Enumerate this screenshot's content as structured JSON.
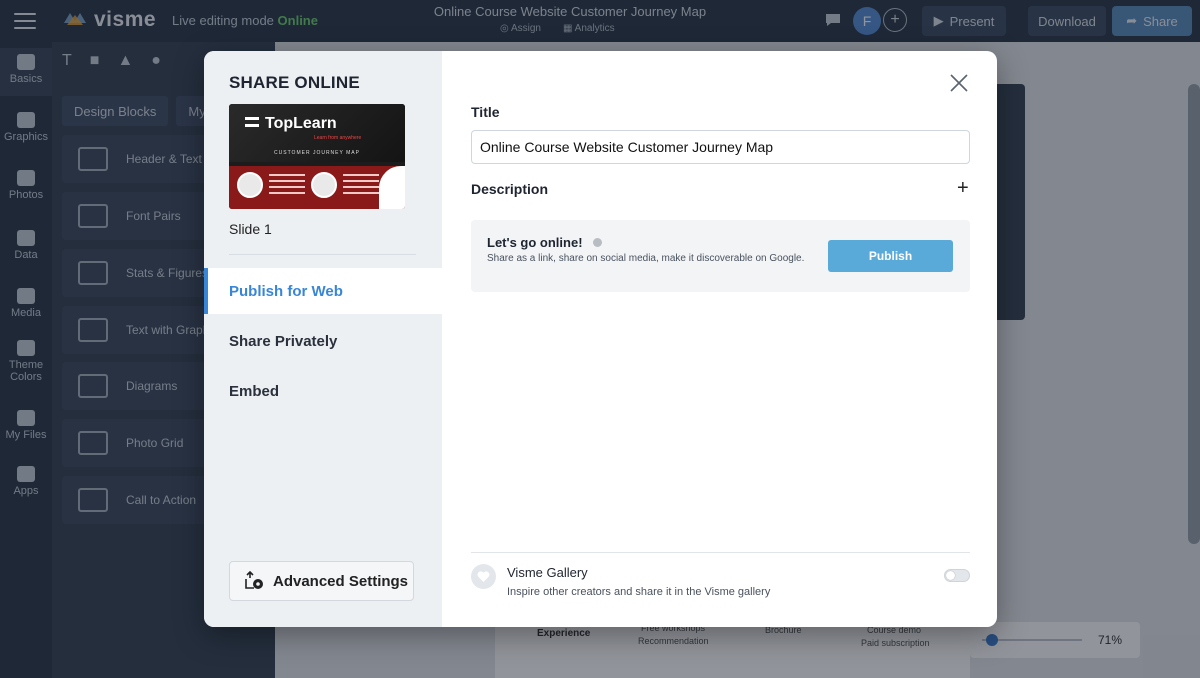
{
  "app": {
    "brand": "visme",
    "mode_text": "Live editing mode",
    "mode_status": "Online",
    "doc_title": "Online Course Website Customer Journey Map",
    "assign_label": "Assign",
    "analytics_label": "Analytics",
    "avatar_initial": "F",
    "present_label": "Present",
    "download_label": "Download",
    "share_label": "Share"
  },
  "rail": {
    "items": [
      {
        "label": "Basics"
      },
      {
        "label": "Graphics"
      },
      {
        "label": "Photos"
      },
      {
        "label": "Data"
      },
      {
        "label": "Media"
      },
      {
        "label": "Theme Colors"
      },
      {
        "label": "My Files"
      },
      {
        "label": "Apps"
      }
    ]
  },
  "panel": {
    "tab_blocks": "Design Blocks",
    "tab_my": "My",
    "blocks": [
      {
        "label": "Header & Text"
      },
      {
        "label": "Font Pairs"
      },
      {
        "label": "Stats & Figures"
      },
      {
        "label": "Text with Graph"
      },
      {
        "label": "Diagrams"
      },
      {
        "label": "Photo Grid"
      },
      {
        "label": "Call to Action"
      }
    ]
  },
  "canvas": {
    "row_label": "Experience",
    "cell_1a": "Free workshops",
    "cell_1b": "Recommendation",
    "cell_2": "Brochure",
    "cell_3a": "Course demo",
    "cell_3b": "Paid subscription",
    "zoom": "71%"
  },
  "modal": {
    "heading": "SHARE ONLINE",
    "thumb": {
      "brand": "TopLearn",
      "tagline": "Learn from anywhere",
      "subtitle": "CUSTOMER JOURNEY MAP"
    },
    "slide_label": "Slide 1",
    "nav": [
      {
        "label": "Publish for Web",
        "active": true
      },
      {
        "label": "Share Privately",
        "active": false
      },
      {
        "label": "Embed",
        "active": false
      }
    ],
    "advanced_label": "Advanced Settings",
    "title_label": "Title",
    "title_value": "Online Course Website Customer Journey Map",
    "description_label": "Description",
    "publish": {
      "heading": "Let's go online!",
      "description": "Share as a link, share on social media, make it discoverable on Google.",
      "button_label": "Publish"
    },
    "gallery": {
      "title": "Visme Gallery",
      "description": "Inspire other creators and share it in the Visme gallery",
      "enabled": false
    }
  },
  "colors": {
    "accent": "#3a86d6",
    "publish_button": "#5aaad9",
    "online_status": "#6fd06f"
  }
}
